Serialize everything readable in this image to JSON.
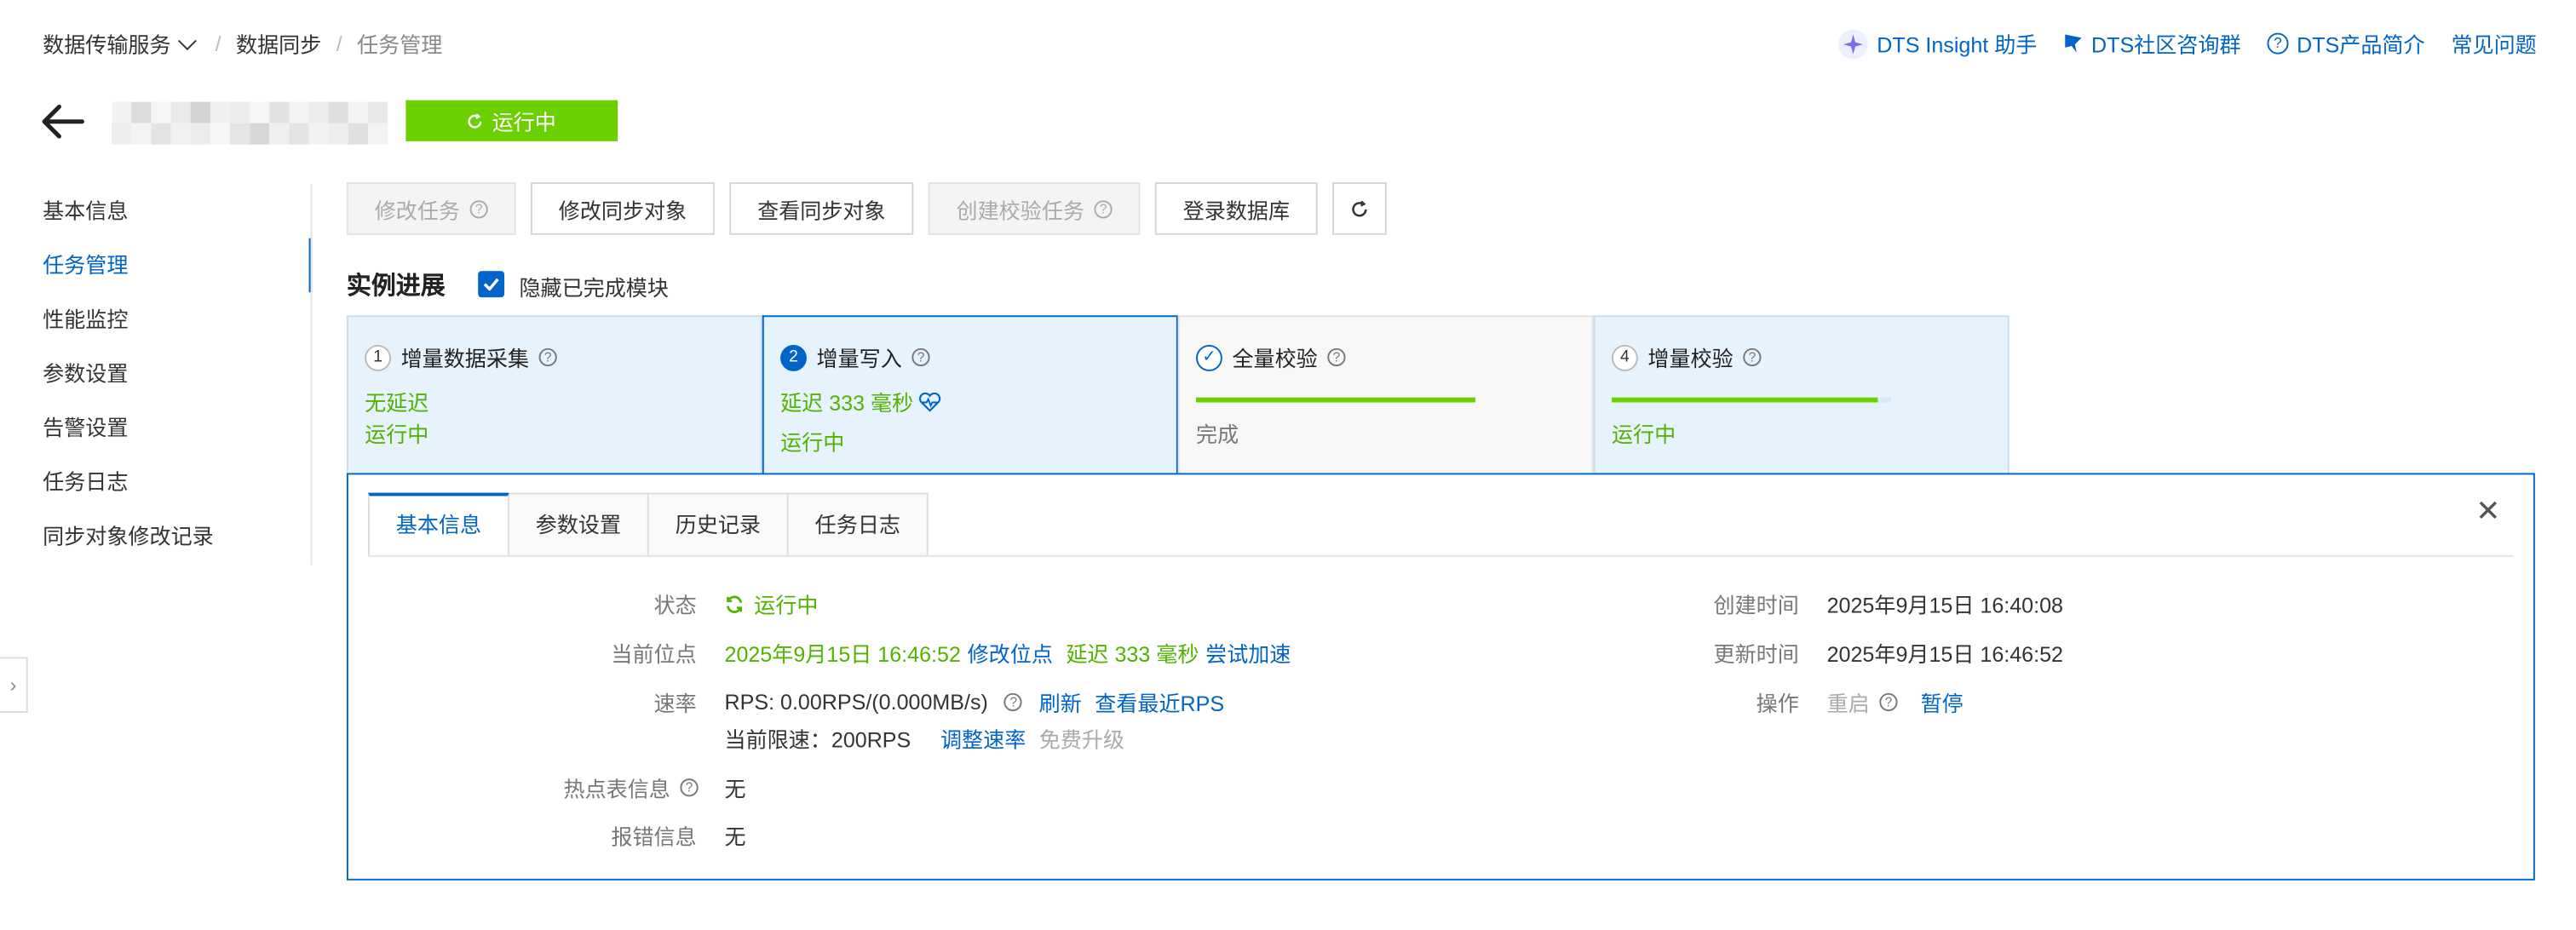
{
  "breadcrumb": {
    "service": "数据传输服务",
    "sync": "数据同步",
    "current": "任务管理"
  },
  "top_links": {
    "insight": "DTS Insight 助手",
    "community": "DTS社区咨询群",
    "product": "DTS产品简介",
    "faq": "常见问题"
  },
  "header": {
    "status": "运行中"
  },
  "nav": [
    "基本信息",
    "任务管理",
    "性能监控",
    "参数设置",
    "告警设置",
    "任务日志",
    "同步对象修改记录"
  ],
  "toolbar": {
    "modify_task": "修改任务",
    "modify_objects": "修改同步对象",
    "view_objects": "查看同步对象",
    "create_check": "创建校验任务",
    "login_db": "登录数据库"
  },
  "progress": {
    "title": "实例进展",
    "hide_done": "隐藏已完成模块"
  },
  "steps": [
    {
      "num": "1",
      "name": "增量数据采集",
      "line1": "无延迟",
      "line2": "运行中"
    },
    {
      "num": "2",
      "name": "增量写入",
      "line1": "延迟 333 毫秒",
      "line2": "运行中"
    },
    {
      "num": "✓",
      "name": "全量校验",
      "line2": "完成",
      "progress": 1.0
    },
    {
      "num": "4",
      "name": "增量校验",
      "line2": "运行中",
      "progress": 0.95
    }
  ],
  "tabs": [
    "基本信息",
    "参数设置",
    "历史记录",
    "任务日志"
  ],
  "detail": {
    "status_label": "状态",
    "status_value": "运行中",
    "position_label": "当前位点",
    "position_value": "2025年9月15日 16:46:52",
    "modify_position": "修改位点",
    "delay": "延迟 333 毫秒",
    "try_speedup": "尝试加速",
    "rate_label": "速率",
    "rate_value": "RPS: 0.00RPS/(0.000MB/s)",
    "refresh": "刷新",
    "recent_rps": "查看最近RPS",
    "limit_value": "当前限速：200RPS",
    "adjust_rate": "调整速率",
    "free_upgrade": "免费升级",
    "hot_label": "热点表信息",
    "hot_value": "无",
    "error_label": "报错信息",
    "error_value": "无",
    "created_label": "创建时间",
    "created_value": "2025年9月15日 16:40:08",
    "updated_label": "更新时间",
    "updated_value": "2025年9月15日 16:46:52",
    "ops_label": "操作",
    "restart": "重启",
    "pause": "暂停"
  },
  "colors": {
    "accent": "#0064c8",
    "running": "#6cd000",
    "ok_text": "#52b200"
  }
}
